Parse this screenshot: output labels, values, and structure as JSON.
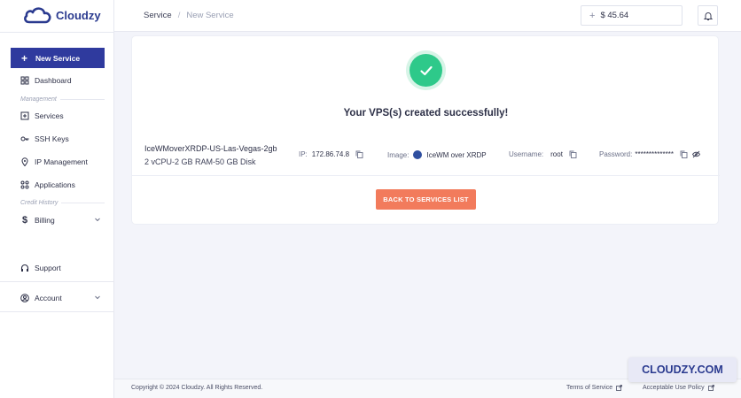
{
  "brand": {
    "name": "Cloudzy",
    "accent": "#2f3a9e",
    "success": "#2ec98a",
    "cta": "#f27b5c"
  },
  "sidebar": {
    "new_service": "New Service",
    "dashboard": "Dashboard",
    "section_management": "Management",
    "services": "Services",
    "ssh_keys": "SSH Keys",
    "ip_management": "IP Management",
    "applications": "Applications",
    "section_credit": "Credit History",
    "billing": "Billing",
    "support": "Support",
    "account": "Account"
  },
  "header": {
    "breadcrumb_root": "Service",
    "breadcrumb_separator": "/",
    "breadcrumb_current": "New Service",
    "balance": "$ 45.64"
  },
  "result": {
    "title": "Your VPS(s) created successfully!",
    "vps_name": "IceWMoverXRDP-US-Las-Vegas-2gb",
    "vps_spec": "2 vCPU-2 GB RAM-50 GB Disk",
    "ip_label": "IP:",
    "ip_value": "172.86.74.8",
    "image_label": "Image:",
    "image_value": "IceWM over XRDP",
    "username_label": "Username:",
    "username_value": "root",
    "password_label": "Password:",
    "password_value": "**************",
    "back_button": "BACK TO SERVICES LIST"
  },
  "footer": {
    "copyright": "Copyright © 2024 Cloudzy. All Rights Reserved.",
    "terms": "Terms of Service",
    "aup": "Acceptable Use Policy"
  },
  "watermark": "CLOUDZY.COM"
}
